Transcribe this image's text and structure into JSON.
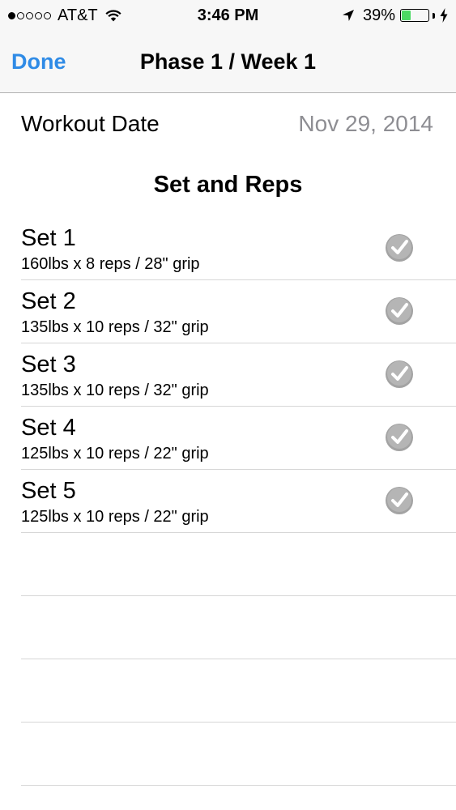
{
  "status_bar": {
    "carrier": "AT&T",
    "time": "3:46 PM",
    "battery_percent": "39%",
    "battery_level": 0.39,
    "signal_bars_filled": 1,
    "signal_bars_total": 5,
    "icons": [
      "wifi-icon",
      "location-arrow-icon",
      "battery-icon",
      "charging-bolt-icon"
    ]
  },
  "nav": {
    "done_label": "Done",
    "title": "Phase 1 / Week 1"
  },
  "workout": {
    "date_label": "Workout Date",
    "date_value": "Nov 29, 2014"
  },
  "section_title": "Set and Reps",
  "sets": [
    {
      "title": "Set 1",
      "detail": "160lbs x 8 reps / 28\" grip"
    },
    {
      "title": "Set 2",
      "detail": "135lbs x 10 reps / 32\" grip"
    },
    {
      "title": "Set 3",
      "detail": "135lbs x 10 reps / 32\" grip"
    },
    {
      "title": "Set 4",
      "detail": "125lbs x 10 reps / 22\" grip"
    },
    {
      "title": "Set 5",
      "detail": "125lbs x 10 reps / 22\" grip"
    }
  ],
  "colors": {
    "accent": "#2f8be6",
    "secondary_text": "#8e8e93",
    "battery": "#4cd964",
    "checkmark": "#9a9a9a"
  }
}
